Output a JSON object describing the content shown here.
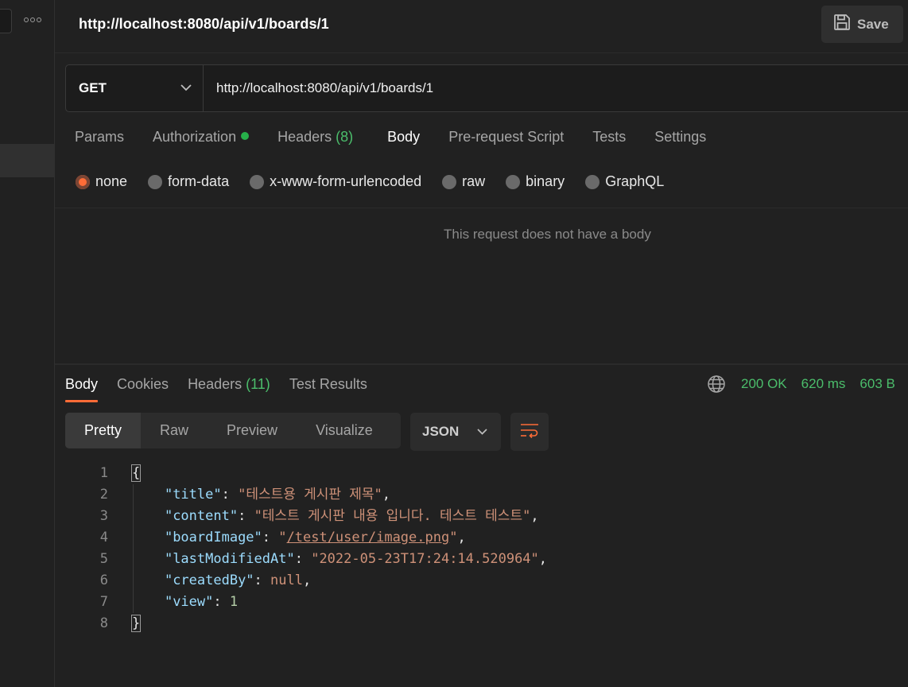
{
  "header": {
    "request_title": "http://localhost:8080/api/v1/boards/1",
    "save_label": "Save"
  },
  "request": {
    "method": "GET",
    "url": "http://localhost:8080/api/v1/boards/1",
    "tabs": {
      "params": "Params",
      "authorization": "Authorization",
      "headers": "Headers",
      "headers_count": "(8)",
      "body": "Body",
      "pre_request": "Pre-request Script",
      "tests": "Tests",
      "settings": "Settings"
    },
    "active_tab": "Body",
    "body_types": [
      "none",
      "form-data",
      "x-www-form-urlencoded",
      "raw",
      "binary",
      "GraphQL"
    ],
    "selected_body_type": "none",
    "empty_message": "This request does not have a body"
  },
  "response": {
    "tabs": {
      "body": "Body",
      "cookies": "Cookies",
      "headers": "Headers",
      "headers_count": "(11)",
      "test_results": "Test Results"
    },
    "status": "200 OK",
    "time": "620 ms",
    "size": "603 B",
    "view_modes": [
      "Pretty",
      "Raw",
      "Preview",
      "Visualize"
    ],
    "active_view": "Pretty",
    "format": "JSON",
    "line_numbers": [
      "1",
      "2",
      "3",
      "4",
      "5",
      "6",
      "7",
      "8"
    ],
    "json": {
      "open": "{",
      "close": "}",
      "title_key": "\"title\"",
      "title_val": "\"테스트용 게시판 제목\"",
      "content_key": "\"content\"",
      "content_val": "\"테스트 게시판 내용 입니다. 테스트 테스트\"",
      "boardImage_key": "\"boardImage\"",
      "boardImage_val": "/test/user/image.png",
      "lastModifiedAt_key": "\"lastModifiedAt\"",
      "lastModifiedAt_val": "\"2022-05-23T17:24:14.520964\"",
      "createdBy_key": "\"createdBy\"",
      "createdBy_val": "null",
      "view_key": "\"view\"",
      "view_val": "1"
    }
  },
  "colors": {
    "accent": "#ff6c37",
    "success": "#4bbd6b",
    "json_key": "#9cdcfe",
    "json_string": "#ce9178"
  }
}
